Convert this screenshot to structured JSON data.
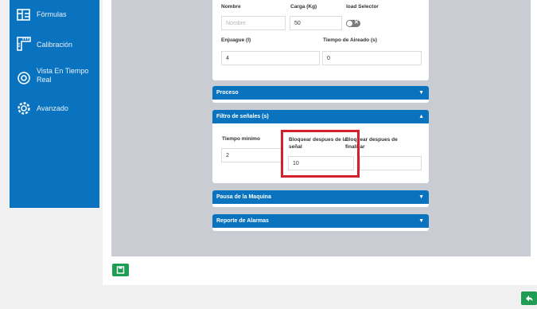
{
  "sidebar": {
    "items": [
      {
        "label": "Fórmulas",
        "icon": "formulas-icon"
      },
      {
        "label": "Calibración",
        "icon": "ruler-icon"
      },
      {
        "label": "Vista En Tiempo Real",
        "icon": "eye-icon"
      },
      {
        "label": "Avanzado",
        "icon": "gear-icon"
      }
    ]
  },
  "form": {
    "nombre_label": "Nombre",
    "nombre_placeholder": "Nombre",
    "carga_label": "Carga (Kg)",
    "carga_value": "50",
    "load_selector_label": "load Selector",
    "enjuague_label": "Enjuague (l)",
    "enjuague_value": "4",
    "tiempo_aireado_label": "Tiempo de Aireado (s)",
    "tiempo_aireado_value": "0"
  },
  "sections": {
    "proceso": "Proceso",
    "filtro": "Filtro de señales (s)",
    "pausa": "Pausa de la Maquina",
    "reporte": "Reporte de Alarmas"
  },
  "filtro": {
    "tiempo_minimo_label": "Tiempo minimo",
    "tiempo_minimo_value": "2",
    "bloquear_senal_label": "Bloquear despues de la señal",
    "bloquear_senal_value": "10",
    "bloquear_finalizar_label": "Bloquear despues de finalizar",
    "bloquear_finalizar_value": ""
  },
  "colors": {
    "primary": "#0a73c0",
    "success": "#1f9d55",
    "highlight": "#d4202a"
  },
  "icons": {
    "save": "save-icon",
    "back": "back-arrow-icon",
    "chevron_down": "chevron-down-icon",
    "chevron_up": "chevron-up-icon"
  }
}
